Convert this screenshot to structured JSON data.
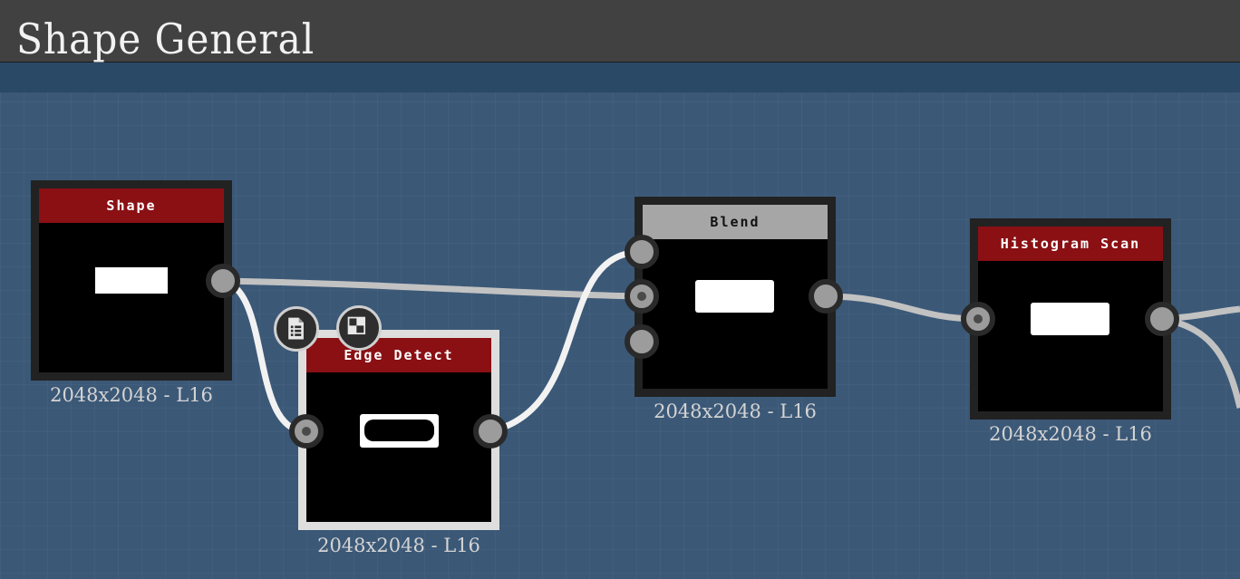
{
  "window": {
    "title": "Shape General"
  },
  "nodes": {
    "shape": {
      "label": "Shape",
      "size": "2048x2048 - L16"
    },
    "edge_detect": {
      "label": "Edge Detect",
      "size": "2048x2048 - L16"
    },
    "blend": {
      "label": "Blend",
      "size": "2048x2048 - L16"
    },
    "histogram_scan": {
      "label": "Histogram Scan",
      "size": "2048x2048 - L16"
    }
  },
  "icons": {
    "node_toolbar": [
      "document-list-icon",
      "checker-preview-icon"
    ]
  },
  "colors": {
    "canvas": "#3b5877",
    "node_header_red": "#8a1014",
    "node_header_gray": "#a6a6a6",
    "wire": "#c2c2c2",
    "wire_selected": "#f2f2f2"
  }
}
